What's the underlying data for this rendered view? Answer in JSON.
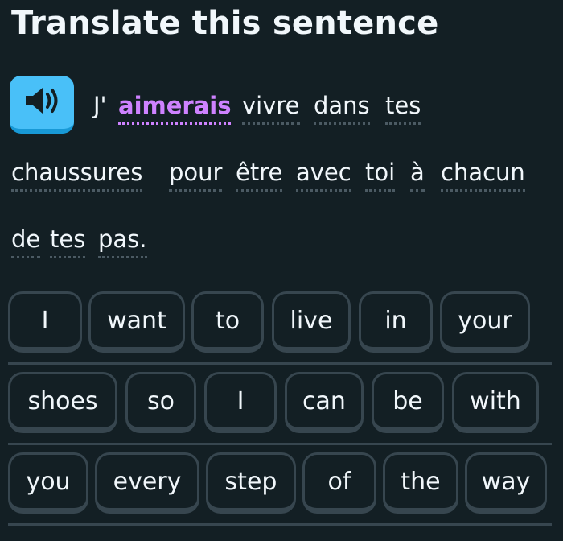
{
  "header": {
    "title": "Translate this sentence"
  },
  "speaker": {
    "icon": "speaker-icon"
  },
  "sentence": {
    "words": [
      "J'",
      "aimerais",
      "vivre",
      "dans",
      "tes",
      "chaussures",
      "pour",
      "être",
      "avec",
      "toi",
      "à",
      "chacun",
      "de",
      "tes",
      "pas."
    ]
  },
  "word_bank": {
    "rows": [
      [
        "I",
        "want",
        "to",
        "live",
        "in",
        "your"
      ],
      [
        "shoes",
        "so",
        "I",
        "can",
        "be",
        "with"
      ],
      [
        "you",
        "every",
        "step",
        "of",
        "the",
        "way"
      ]
    ]
  },
  "colors": {
    "background": "#131f24",
    "highlight": "#ce82ff",
    "speaker": "#49c0f8",
    "border": "#37464f"
  }
}
